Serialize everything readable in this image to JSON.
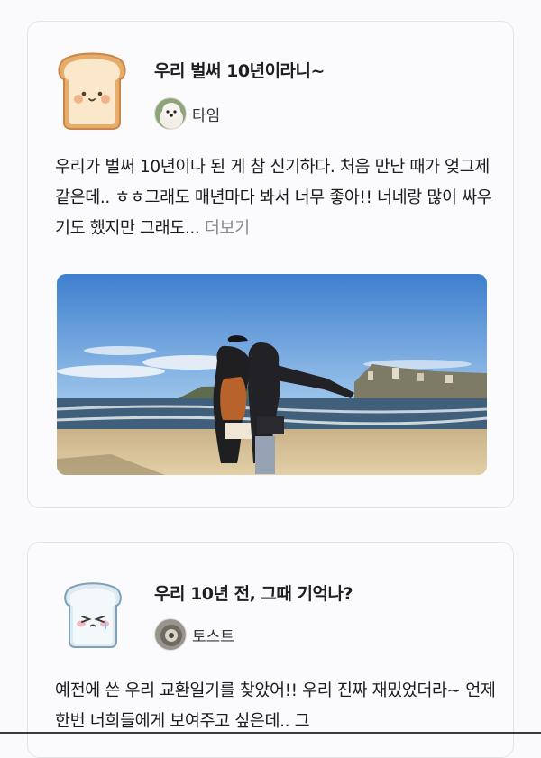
{
  "posts": [
    {
      "title": "우리 벌써 10년이라니~",
      "author": "타임",
      "body": "우리가 벌써 10년이나 된 게 참 신기하다. 처음 만난 때가 엊그제 같은데.. ㅎㅎ그래도 매년마다 봐서 너무 좋아!! 너네랑 많이 싸우기도 했지만 그래도...",
      "more_label": " 더보기"
    },
    {
      "title": "우리 10년 전, 그때 기억나?",
      "author": "토스트",
      "body": "예전에 쓴 우리 교환일기를 찾았어!! 우리 진짜 재밌었더라~ 언제 한번 너희들에게 보여주고 싶은데.. 그"
    }
  ],
  "icons": {
    "post1_icon": "toast-bread-icon",
    "post2_icon": "crying-toast-icon"
  },
  "colors": {
    "card_background": "#fbfafc",
    "card_border": "#e4e2e6",
    "more_link": "#8a8a8a"
  }
}
